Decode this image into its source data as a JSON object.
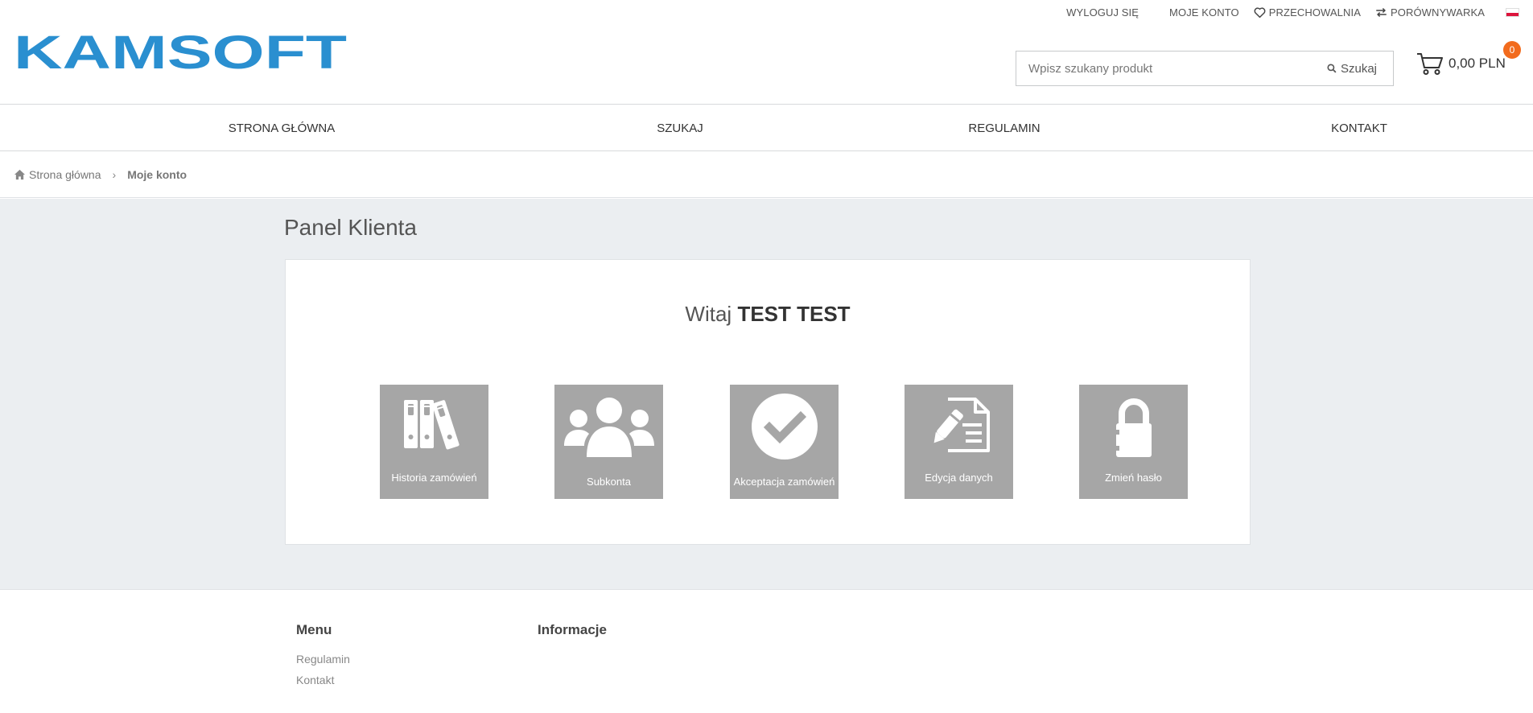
{
  "header": {
    "logo_text": "KAMSOFT",
    "logo_color": "#2a8fd0",
    "top_links": {
      "logout": "WYLOGUJ SIĘ",
      "account": "MOJE KONTO",
      "storage": "PRZECHOWALNIA",
      "compare": "PORÓWNYWARKA"
    },
    "search": {
      "placeholder": "Wpisz szukany produkt",
      "button_label": "Szukaj"
    },
    "cart": {
      "amount": "0,00 PLN",
      "count": "0",
      "badge_color": "#f26b1d"
    }
  },
  "nav": {
    "items": [
      "STRONA GŁÓWNA",
      "SZUKAJ",
      "REGULAMIN",
      "KONTAKT"
    ]
  },
  "breadcrumb": {
    "home": "Strona główna",
    "separator": "›",
    "current": "Moje konto"
  },
  "main": {
    "title": "Panel Klienta",
    "welcome_prefix": "Witaj",
    "welcome_name": "TEST TEST",
    "tiles": [
      {
        "label": "Historia zamówień",
        "icon": "binders-icon"
      },
      {
        "label": "Subkonta",
        "icon": "users-icon"
      },
      {
        "label": "Akceptacja zamówień",
        "icon": "check-circle-icon"
      },
      {
        "label": "Edycja danych",
        "icon": "edit-document-icon"
      },
      {
        "label": "Zmień hasło",
        "icon": "lock-icon"
      }
    ],
    "tile_color": "#a6a6a6"
  },
  "footer": {
    "menu_title": "Menu",
    "menu_links": [
      "Regulamin",
      "Kontakt"
    ],
    "info_title": "Informacje"
  }
}
